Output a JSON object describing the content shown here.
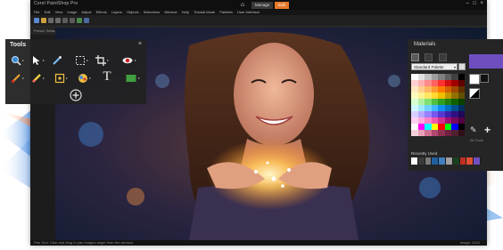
{
  "app": {
    "title": "Corel PaintShop Pro",
    "tabs": {
      "home_icon": "home-icon",
      "manage": "Manage",
      "edit": "Edit"
    },
    "menu": [
      "File",
      "Edit",
      "View",
      "Image",
      "Adjust",
      "Effects",
      "Layers",
      "Objects",
      "Selections",
      "Window",
      "Help",
      "Tutorial Mode",
      "Palettes",
      "User Interface"
    ],
    "options_text": "Preset: Default   Stroke: 1   Antialias",
    "status_left": "Pan Tool: Click and drag to pan images larger than the window.",
    "status_right": "Image: 1024"
  },
  "tools_panel": {
    "title": "Tools",
    "close": "×",
    "rows": [
      [
        "zoom-tool-icon",
        "pick-tool-icon",
        "eyedropper-tool-icon",
        "selection-tool-icon",
        "crop-tool-icon",
        "redeye-tool-icon"
      ],
      [
        "paintbrush-tool-icon",
        "scratch-remover-tool-icon",
        "clone-tool-icon",
        "fill-tool-icon",
        "text-tool-icon",
        "rectangle-tool-icon"
      ]
    ],
    "text_glyph": "T",
    "add_glyph": "+"
  },
  "materials_panel": {
    "title": "Materials",
    "close": "×",
    "palette": "Standard Palette",
    "recently_used_label": "Recently Used",
    "caption": "All Tools",
    "add_glyph": "+",
    "colors": {
      "foreground": "#6f4fc0",
      "accent": "#e8782a"
    },
    "swatches": [
      "#ffffff",
      "#e0e0e0",
      "#c0c0c0",
      "#a0a0a0",
      "#808080",
      "#606060",
      "#404040",
      "#000000",
      "#ffd0d0",
      "#ffb0b0",
      "#ff8a8a",
      "#ff6060",
      "#ff3030",
      "#d01010",
      "#a00000",
      "#600000",
      "#ffe8c0",
      "#ffd090",
      "#ffb860",
      "#ff9a30",
      "#ff7b00",
      "#d06000",
      "#a04800",
      "#603000",
      "#fffbc0",
      "#fff290",
      "#ffe860",
      "#ffd830",
      "#f0c000",
      "#c09800",
      "#907000",
      "#605000",
      "#d8ffd0",
      "#b0f0a0",
      "#80e070",
      "#50c040",
      "#30a020",
      "#208010",
      "#106000",
      "#084000",
      "#d0f8ff",
      "#a0e8ff",
      "#70d0ff",
      "#40b8ff",
      "#1090f0",
      "#0070c0",
      "#005090",
      "#003060",
      "#d8d0ff",
      "#b8a8ff",
      "#9880ff",
      "#7858f0",
      "#5838d0",
      "#4020a8",
      "#301080",
      "#200858",
      "#ffd0f0",
      "#ffa8e0",
      "#ff80c8",
      "#f058b0",
      "#d03090",
      "#a01070",
      "#780858",
      "#500040",
      "#ffffff",
      "#ff00ff",
      "#00ffff",
      "#ffff00",
      "#ff0000",
      "#00ff00",
      "#0000ff",
      "#000000",
      "#f5d0d8",
      "#e8a0b8",
      "#d07090",
      "#b04870",
      "#903050",
      "#702040",
      "#502030",
      "#301018"
    ],
    "recent": [
      "#ffffff",
      "#3a3a3a",
      "#7a7a7a",
      "#2060a0",
      "#4080c0",
      "#a0a0a0",
      "#1a4020",
      "#c03020",
      "#e05030",
      "#6f4fc0"
    ]
  }
}
